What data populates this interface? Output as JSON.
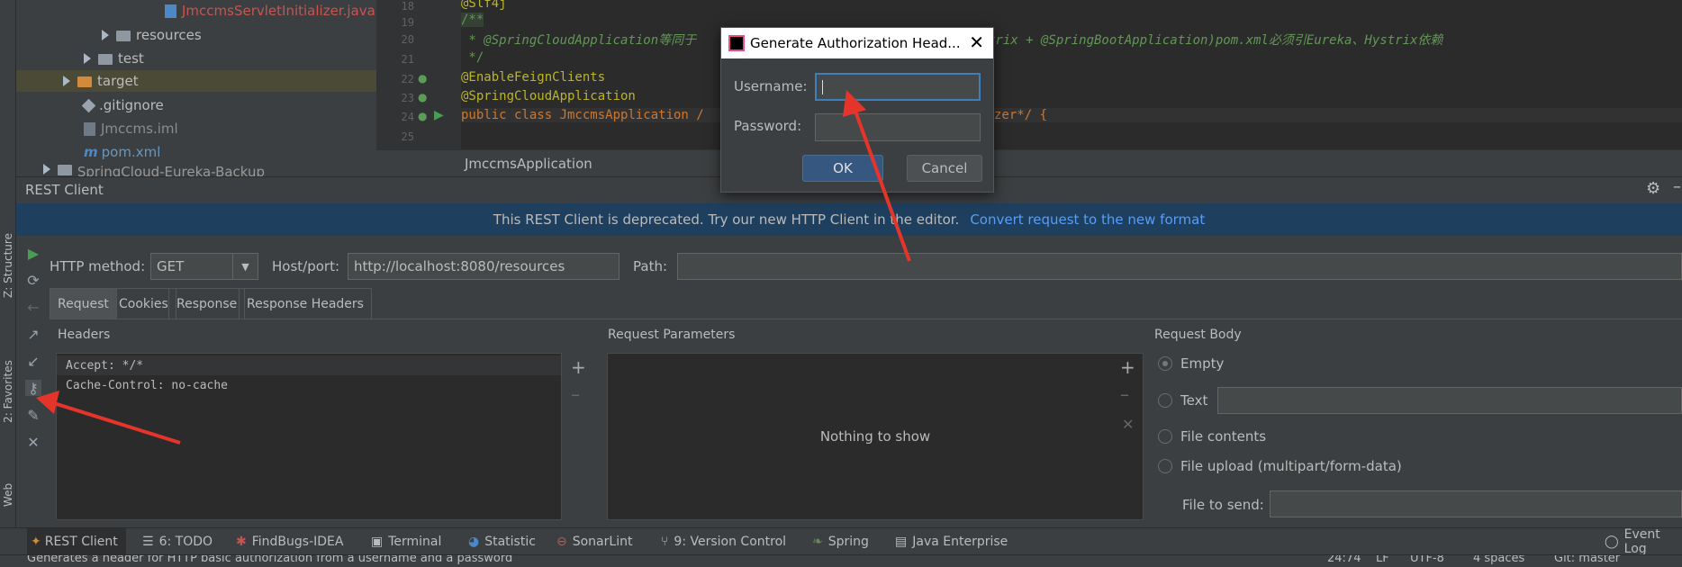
{
  "left_strip": {
    "structure_label": "Z: Structure",
    "favorites_label": "2: Favorites",
    "web_label": "Web"
  },
  "project_tree": {
    "items": [
      {
        "label": "JmccmsServletInitializer.java"
      },
      {
        "label": "resources"
      },
      {
        "label": "test"
      },
      {
        "label": "target"
      },
      {
        "label": ".gitignore"
      },
      {
        "label": "Jmccms.iml"
      },
      {
        "label": "pom.xml"
      },
      {
        "label": "SpringCloud-Eureka-Backup [SpringCloudEur"
      }
    ]
  },
  "editor": {
    "line_numbers": [
      "18",
      "19",
      "20",
      "21",
      "22",
      "23",
      "24",
      "25"
    ],
    "lines": [
      "@Slf4j",
      "/**",
      " * @SpringCloudApplication等同于 ",
      " */",
      "@EnableFeignClients",
      "@SpringCloudApplication",
      "public class JmccmsApplication /",
      ""
    ],
    "line20_tail": "trix + @SpringBootApplication)pom.xml必须引Eureka、Hystrix依赖",
    "line24_tail": "zer*/ {",
    "breadcrumb": "JmccmsApplication"
  },
  "rest_client": {
    "title": "REST Client",
    "banner_text": "This REST Client is deprecated. Try our new HTTP Client in the editor.",
    "banner_link": "Convert request to the new format",
    "http_method_label": "HTTP method:",
    "http_method_value": "GET",
    "host_label": "Host/port:",
    "host_value": "http://localhost:8080/resources",
    "path_label": "Path:",
    "tabs": [
      "Request",
      "Cookies",
      "Response",
      "Response Headers"
    ],
    "headers_title": "Headers",
    "headers": [
      "Accept: */*",
      "Cache-Control: no-cache"
    ],
    "params_title": "Request Parameters",
    "params_empty": "Nothing to show",
    "body_title": "Request Body",
    "body_options": [
      "Empty",
      "Text",
      "File contents",
      "File upload (multipart/form-data)"
    ],
    "file_to_send_label": "File to send:"
  },
  "dialog": {
    "title": "Generate Authorization Head...",
    "username_label": "Username:",
    "password_label": "Password:",
    "ok_label": "OK",
    "cancel_label": "Cancel"
  },
  "bottom_tabs": [
    {
      "label": "REST Client"
    },
    {
      "label": "6: TODO"
    },
    {
      "label": "FindBugs-IDEA"
    },
    {
      "label": "Terminal"
    },
    {
      "label": "Statistic"
    },
    {
      "label": "SonarLint"
    },
    {
      "label": "9: Version Control"
    },
    {
      "label": "Spring"
    },
    {
      "label": "Java Enterprise"
    },
    {
      "label": "Event Log"
    }
  ],
  "status_bar": {
    "message": "Generates a header for HTTP basic authorization from a username and a password",
    "position": "24:74",
    "line_sep": "LF",
    "encoding": "UTF-8",
    "indent": "4 spaces",
    "vcs": "Git: master"
  },
  "colors": {
    "accent_link": "#589df6",
    "annotation_red": "#e5352b",
    "banner_bg": "#1e3f5e"
  }
}
